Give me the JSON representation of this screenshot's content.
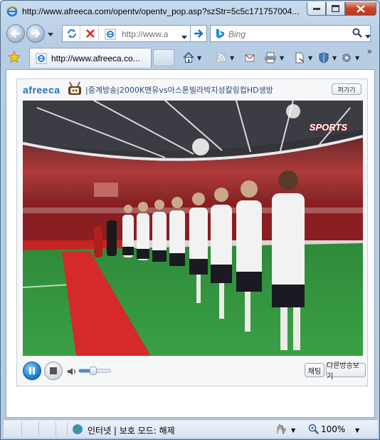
{
  "window": {
    "title": "http://www.afreeca.com/opentv/opentv_pop.asp?szStr=5c5c171757004..."
  },
  "nav": {
    "address": "http://www.a",
    "search_placeholder": "Bing"
  },
  "tabs": [
    {
      "label": "http://www.afreeca.co..."
    }
  ],
  "player": {
    "logo": "afreeca",
    "title": "|중계방송|2000K맨유vs아스톤빌라박지성칼링컵HD생방",
    "popout_label": "퍼가기",
    "channel_logo": "SPORTS",
    "chat_label": "채팅",
    "other_label": "다른방송보기",
    "volume_level": 0.45
  },
  "status": {
    "zone": "인터넷 | 보호 모드: 해제",
    "zoom": "100%"
  },
  "colors": {
    "afreeca_blue": "#2a6fb8",
    "play_blue": "#1e7fd0"
  }
}
